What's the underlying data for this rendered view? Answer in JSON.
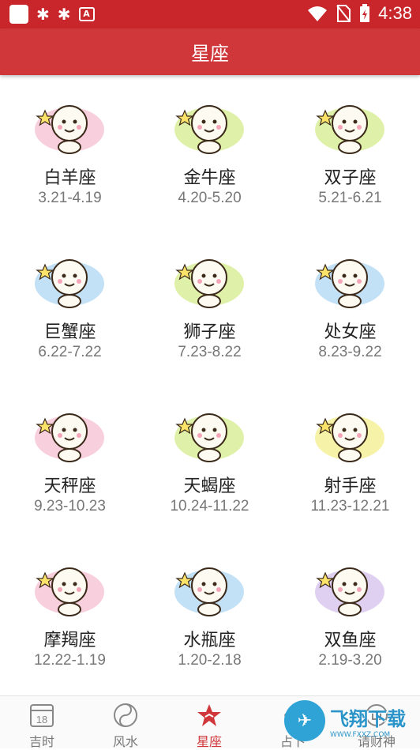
{
  "status_bar": {
    "time": "4:38",
    "notification_icons": [
      "square-icon",
      "bug-icon",
      "bug-icon",
      "text-a-icon"
    ]
  },
  "header": {
    "title": "星座"
  },
  "zodiac": [
    {
      "name": "白羊座",
      "range": "3.21-4.19",
      "icon": "aries-sheep-icon",
      "bg": "#f7c7d6"
    },
    {
      "name": "金牛座",
      "range": "4.20-5.20",
      "icon": "taurus-bull-icon",
      "bg": "#d9ef9a"
    },
    {
      "name": "双子座",
      "range": "5.21-6.21",
      "icon": "gemini-twins-icon",
      "bg": "#d9ef9a"
    },
    {
      "name": "巨蟹座",
      "range": "6.22-7.22",
      "icon": "cancer-crab-icon",
      "bg": "#b9dcf5"
    },
    {
      "name": "狮子座",
      "range": "7.23-8.22",
      "icon": "leo-lion-icon",
      "bg": "#d9ef9a"
    },
    {
      "name": "处女座",
      "range": "8.23-9.22",
      "icon": "virgo-girl-icon",
      "bg": "#b9dcf5"
    },
    {
      "name": "天秤座",
      "range": "9.23-10.23",
      "icon": "libra-scales-icon",
      "bg": "#f7c7d6"
    },
    {
      "name": "天蝎座",
      "range": "10.24-11.22",
      "icon": "scorpio-scorpion-icon",
      "bg": "#d9ef9a"
    },
    {
      "name": "射手座",
      "range": "11.23-12.21",
      "icon": "sagittarius-bow-icon",
      "bg": "#f5f19a"
    },
    {
      "name": "摩羯座",
      "range": "12.22-1.19",
      "icon": "capricorn-goat-icon",
      "bg": "#f7c7d6"
    },
    {
      "name": "水瓶座",
      "range": "1.20-2.18",
      "icon": "aquarius-jar-icon",
      "bg": "#b9dcf5"
    },
    {
      "name": "双鱼座",
      "range": "2.19-3.20",
      "icon": "pisces-fish-icon",
      "bg": "#d9c8ee"
    }
  ],
  "tabs": [
    {
      "label": "吉时",
      "icon": "calendar-icon",
      "calendar_day": "18",
      "active": false
    },
    {
      "label": "风水",
      "icon": "yin-yang-icon",
      "active": false
    },
    {
      "label": "星座",
      "icon": "star-icon",
      "active": true
    },
    {
      "label": "占卜",
      "icon": "divination-icon",
      "active": false
    },
    {
      "label": "请财神",
      "icon": "fortune-god-icon",
      "active": false
    }
  ],
  "watermark": {
    "text": "飞翔下载",
    "url": "WWW.FXXZ.COM"
  },
  "colors": {
    "primary": "#d0373a",
    "status_bar": "#c8262b",
    "tab_inactive": "#777777",
    "tab_active": "#d0373a"
  }
}
